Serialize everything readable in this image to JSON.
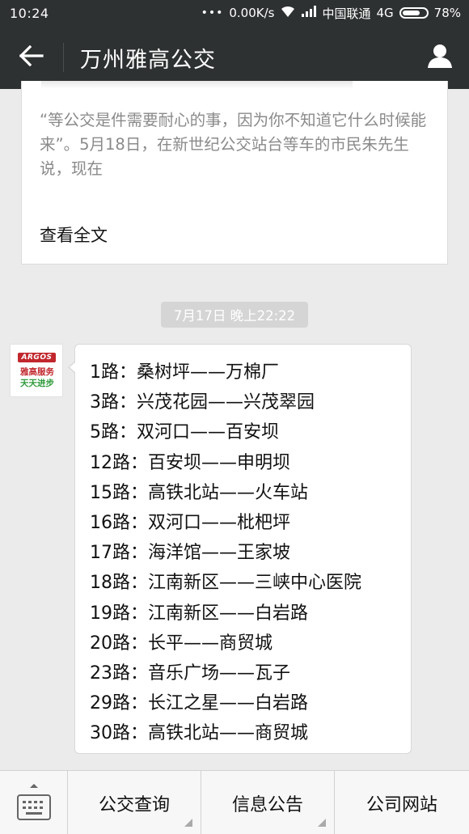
{
  "status_bar": {
    "time": "10:24",
    "dots": "•••",
    "network_speed": "0.00K/s",
    "carrier": "中国联通",
    "network_type": "4G",
    "battery": "78%",
    "battery_level": 0.78
  },
  "nav": {
    "title": "万州雅高公交",
    "back_icon": "back-arrow-icon",
    "profile_icon": "person-icon"
  },
  "article": {
    "excerpt": "“等公交是件需要耐心的事，因为你不知道它什么时候能来”。5月18日，在新世纪公交站台等车的市民朱先生说，现在",
    "read_more": "查看全文"
  },
  "timestamp": "7月17日 晚上22:22",
  "avatar": {
    "logo_text": "ARGOS",
    "line1": "雅高服务",
    "line2": "天天进步"
  },
  "message": {
    "routes": [
      "1路：桑树坪——万棉厂",
      "3路：兴茂花园——兴茂翠园",
      "5路：双河口——百安坝",
      "12路：百安坝——申明坝",
      "15路：高铁北站——火车站",
      "16路：双河口——枇杷坪",
      "17路：海洋馆——王家坡",
      "18路：江南新区——三峡中心医院",
      "19路：江南新区——白岩路",
      "20路：长平——商贸城",
      "23路：音乐广场——瓦子",
      "29路：长江之星——白岩路",
      "30路：高铁北站——商贸城"
    ]
  },
  "bottom_menu": {
    "keyboard_icon": "keyboard-icon",
    "items": [
      {
        "label": "公交查询"
      },
      {
        "label": "信息公告"
      },
      {
        "label": "公司网站"
      }
    ]
  }
}
